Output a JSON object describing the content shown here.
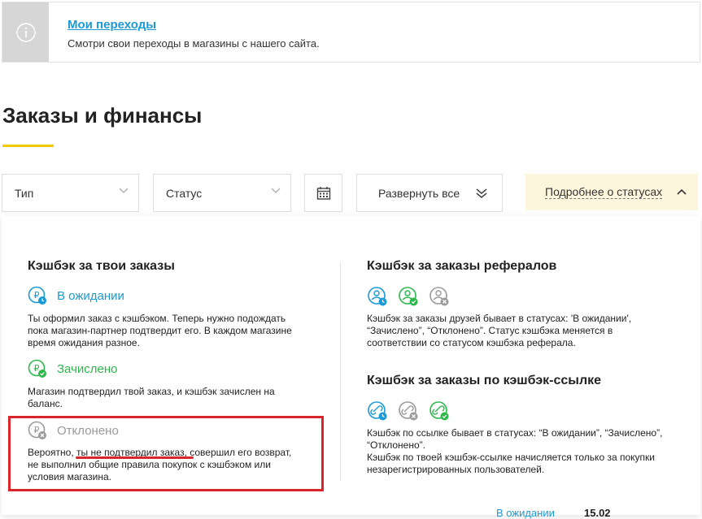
{
  "notice": {
    "title": "Мои переходы",
    "text": "Смотри свои переходы в магазины с нашего сайта.",
    "icon": "info-icon"
  },
  "page": {
    "title": "Заказы и финансы",
    "accent": "#f5c800"
  },
  "filters": {
    "type": "Тип",
    "status": "Статус",
    "expand_all": "Развернуть все",
    "details": "Подробнее о статусах"
  },
  "own_orders": {
    "title": "Кэшбэк за твои заказы",
    "statuses": [
      {
        "label": "В ожидании",
        "color": "#1a9ad6",
        "text": [
          "Ты оформил заказ с кэшбэком. Теперь нужно подождать",
          "пока магазин-партнер подтвердит его. В каждом магазине",
          "время ожидания разное."
        ]
      },
      {
        "label": "Зачислено",
        "color": "#2db84c",
        "text": [
          "Магазин подтвердил твой заказ, и кэшбэк зачислен на",
          "баланс."
        ]
      },
      {
        "label": "Отклонено",
        "color": "#9a9a9a",
        "text": [
          "Вероятно, ты не подтвердил заказ, совершил его возврат,",
          "не выполнил общие правила покупок с кэшбэком или",
          "условия магазина."
        ]
      }
    ]
  },
  "referral_orders": {
    "title": "Кэшбэк за заказы рефералов",
    "text": [
      "Кэшбэк за заказы друзей бывает в статусах: 'В ожидании',",
      "“Зачислено”, “Отклонено”. Статус кэшбэка меняется в",
      "соответствии со статусом кэшбэка реферала."
    ]
  },
  "link_orders": {
    "title": "Кэшбэк за заказы по кэшбэк-ссылке",
    "text": [
      "Кэшбэк по ссылке бывает в статусах: “В ожидании”, “Зачислено”,",
      "“Отклонено”.",
      "Кэшбэк по твоей кэшбэк-ссылке начисляется только за покупки",
      "незарегистрированных пользователей."
    ]
  },
  "highlight_color": "#d9252b",
  "bottom": {
    "status": "В ожидании",
    "value": "15.02"
  }
}
